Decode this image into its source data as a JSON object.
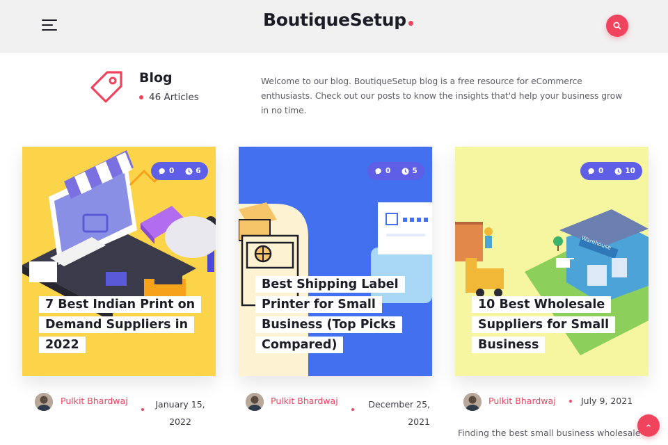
{
  "header": {
    "logo": "BoutiqueSetup",
    "menu_icon": "hamburger-menu-icon",
    "search_icon": "search-icon",
    "accent_color": "#f0445e"
  },
  "intro": {
    "title": "Blog",
    "article_count": "46 Articles",
    "description": "Welcome to our blog. BoutiqueSetup blog is a free resource for eCommerce enthusiasts. Check out our posts to know the insights that'd help your business grow in no time."
  },
  "cards": [
    {
      "title": "7 Best Indian Print on Demand Suppliers in 2022",
      "comments": "0",
      "read_minutes": "6",
      "author": "Pulkit Bhardwaj",
      "date": "January 15, 2022",
      "bg_color": "#fbd44a"
    },
    {
      "title": "Best Shipping Label Printer for Small Business (Top Picks Compared)",
      "comments": "0",
      "read_minutes": "5",
      "author": "Pulkit Bhardwaj",
      "date": "December 25, 2021",
      "bg_color": "#4270ee"
    },
    {
      "title": "10 Best Wholesale Suppliers for Small Business",
      "comments": "0",
      "read_minutes": "10",
      "author": "Pulkit Bhardwaj",
      "date": "July 9, 2021",
      "bg_color": "#f6f6a0",
      "excerpt": "Finding the best small business wholesale"
    }
  ],
  "illustration_text": {
    "warehouse_sign": "Warehouse"
  },
  "scroll_top_icon": "chevron-up-icon"
}
